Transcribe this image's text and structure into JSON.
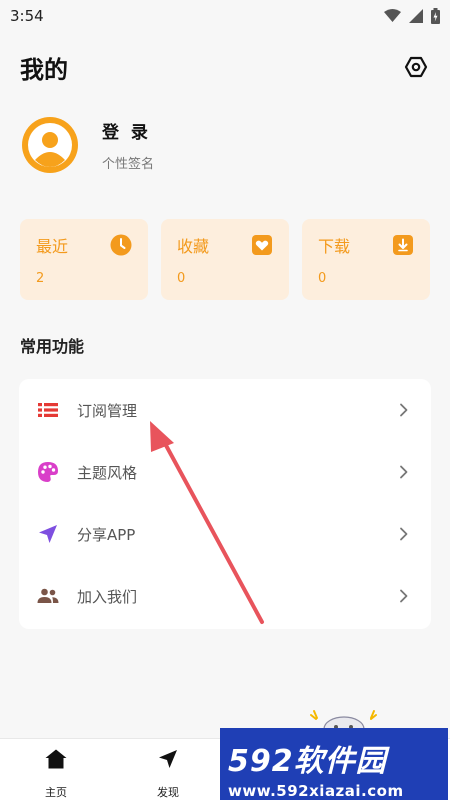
{
  "status_bar": {
    "time": "3:54",
    "icons": [
      "wifi-icon",
      "signal-icon",
      "battery-icon"
    ]
  },
  "header": {
    "title": "我的",
    "settings_icon": "settings-hexagon-icon"
  },
  "profile": {
    "name": "登 录",
    "signature": "个性签名",
    "avatar_color": "#f7a21b"
  },
  "stats": [
    {
      "label": "最近",
      "count": "2",
      "icon": "clock-icon"
    },
    {
      "label": "收藏",
      "count": "0",
      "icon": "heart-icon"
    },
    {
      "label": "下载",
      "count": "0",
      "icon": "download-icon"
    }
  ],
  "section": {
    "title": "常用功能"
  },
  "menu": [
    {
      "label": "订阅管理",
      "icon": "list-icon",
      "color": "#e53935"
    },
    {
      "label": "主题风格",
      "icon": "palette-icon",
      "color": "#d93fc9"
    },
    {
      "label": "分享APP",
      "icon": "send-icon",
      "color": "#7e4fe0"
    },
    {
      "label": "加入我们",
      "icon": "group-icon",
      "color": "#7a5548"
    }
  ],
  "tabs": [
    {
      "label": "主页",
      "icon": "home-icon"
    },
    {
      "label": "发现",
      "icon": "navigation-icon"
    }
  ],
  "watermark": {
    "brand_number": "592",
    "brand_text": "软件园",
    "url": "www.592xiazai.com"
  },
  "colors": {
    "accent": "#f39a1d",
    "card_bg": "#fdeedd",
    "background": "#f7f7f7",
    "annotation_arrow": "#e8545c",
    "watermark_bg": "#1f3fb5"
  }
}
